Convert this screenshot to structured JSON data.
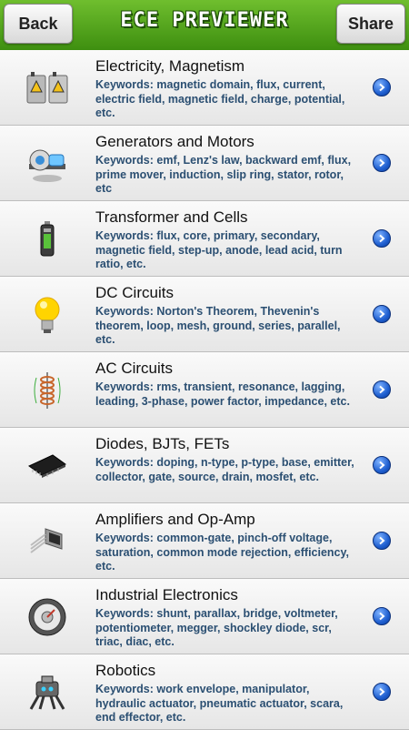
{
  "header": {
    "back_label": "Back",
    "title": "ECE PREVIEWER",
    "share_label": "Share"
  },
  "colors": {
    "header_green": "#4ea31c",
    "keyword_blue": "#2b4f72",
    "chevron_blue": "#1f5fd0"
  },
  "topics": [
    {
      "title": "Electricity, Magnetism",
      "keywords": "Keywords: magnetic domain, flux, current, electric field, magnetic field, charge, potential, etc.",
      "icon": "electrical-panels-icon"
    },
    {
      "title": "Generators and Motors",
      "keywords": "Keywords: emf, Lenz's law, backward emf, flux, prime mover, induction, slip ring, stator, rotor, etc",
      "icon": "generator-icon"
    },
    {
      "title": "Transformer and Cells",
      "keywords": "Keywords: flux, core, primary, secondary, magnetic field, step-up, anode, lead acid, turn ratio, etc.",
      "icon": "battery-icon"
    },
    {
      "title": "DC Circuits",
      "keywords": "Keywords: Norton's Theorem, Thevenin's theorem, loop, mesh, ground, series, parallel, etc.",
      "icon": "light-bulb-icon"
    },
    {
      "title": "AC Circuits",
      "keywords": "Keywords: rms, transient, resonance, lagging, leading, 3-phase, power factor, impedance, etc.",
      "icon": "coil-icon"
    },
    {
      "title": "Diodes, BJTs, FETs",
      "keywords": "Keywords: doping, n-type, p-type, base, emitter, collector, gate, source, drain, mosfet, etc.",
      "icon": "ic-chip-icon"
    },
    {
      "title": "Amplifiers and Op-Amp",
      "keywords": "Keywords: common-gate, pinch-off voltage, saturation, common mode rejection, efficiency, etc.",
      "icon": "transistor-icon"
    },
    {
      "title": "Industrial Electronics",
      "keywords": "Keywords: shunt, parallax, bridge, voltmeter, potentiometer, megger, shockley diode, scr, triac, diac, etc.",
      "icon": "dial-meter-icon"
    },
    {
      "title": "Robotics",
      "keywords": "Keywords: work envelope, manipulator, hydraulic actuator, pneumatic actuator, scara, end effector, etc.",
      "icon": "robot-icon"
    }
  ]
}
